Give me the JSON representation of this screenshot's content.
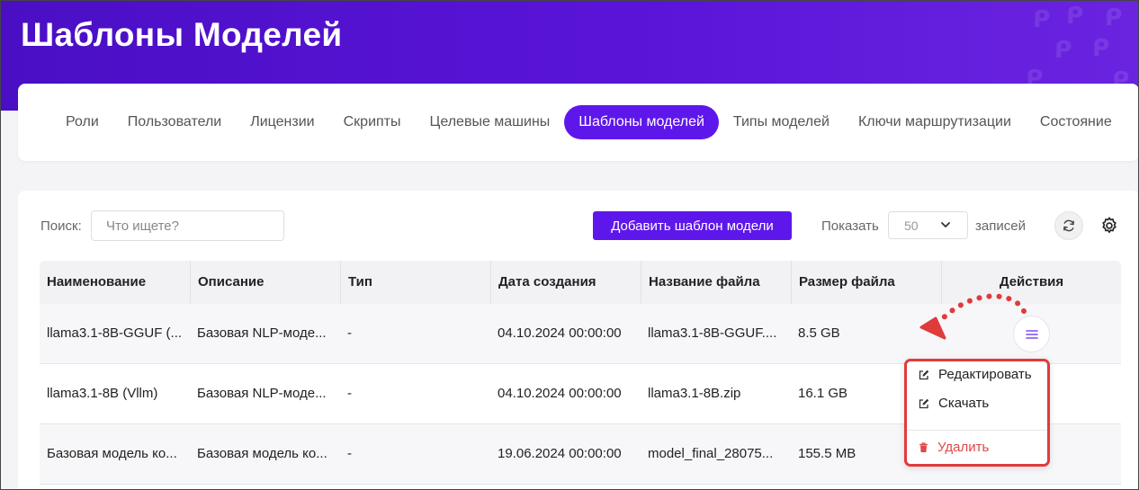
{
  "header": {
    "title": "Шаблоны Моделей"
  },
  "nav": {
    "tabs": [
      {
        "label": "Роли"
      },
      {
        "label": "Пользователи"
      },
      {
        "label": "Лицензии"
      },
      {
        "label": "Скрипты"
      },
      {
        "label": "Целевые машины"
      },
      {
        "label": "Шаблоны моделей",
        "active": true
      },
      {
        "label": "Типы моделей"
      },
      {
        "label": "Ключи маршрутизации"
      },
      {
        "label": "Состояние"
      }
    ]
  },
  "toolbar": {
    "search_label": "Поиск:",
    "search_placeholder": "Что ищете?",
    "add_button": "Добавить шаблон модели",
    "show_label": "Показать",
    "page_size": "50",
    "records_label": "записей"
  },
  "table": {
    "columns": [
      "Наименование",
      "Описание",
      "Тип",
      "Дата создания",
      "Название файла",
      "Размер файла",
      "Действия"
    ],
    "rows": [
      {
        "name": "llama3.1-8B-GGUF (...",
        "description": "Базовая NLP-моде...",
        "type": "-",
        "created": "04.10.2024 00:00:00",
        "filename": "llama3.1-8B-GGUF....",
        "size": "8.5 GB"
      },
      {
        "name": "llama3.1-8B (Vllm)",
        "description": "Базовая NLP-моде...",
        "type": "-",
        "created": "04.10.2024 00:00:00",
        "filename": "llama3.1-8B.zip",
        "size": "16.1 GB"
      },
      {
        "name": "Базовая модель ко...",
        "description": "Базовая модель ко...",
        "type": "-",
        "created": "19.06.2024 00:00:00",
        "filename": "model_final_28075...",
        "size": "155.5 MB"
      }
    ]
  },
  "action_menu": {
    "items": [
      {
        "label": "Редактировать",
        "icon": "edit-icon"
      },
      {
        "label": "Скачать",
        "icon": "edit-icon"
      },
      {
        "label": "Удалить",
        "icon": "trash-icon",
        "danger": true
      }
    ]
  },
  "colors": {
    "accent": "#5e17eb",
    "banner": "#4a0fc4",
    "highlight": "#e03b3b",
    "danger": "#e04848"
  }
}
